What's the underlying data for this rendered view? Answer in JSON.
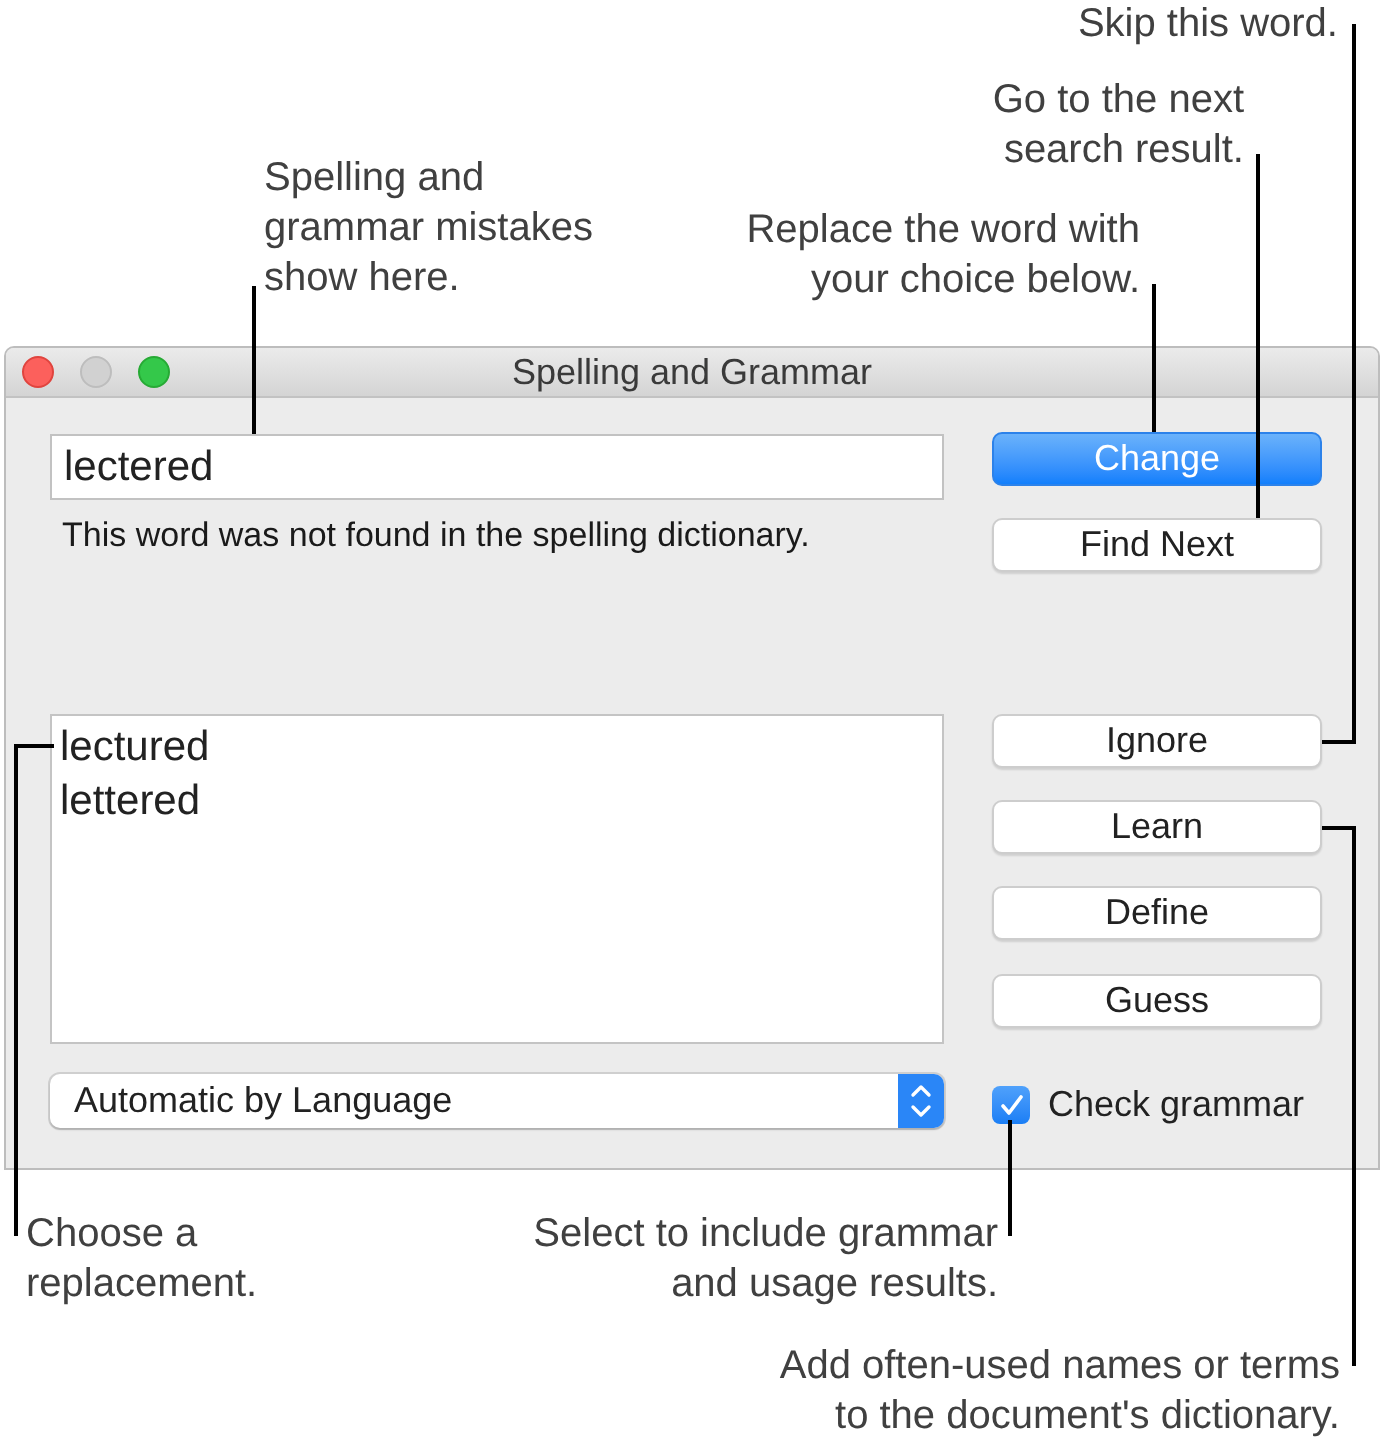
{
  "callouts_top": [
    {
      "lines": [
        "Skip this word."
      ]
    },
    {
      "lines": [
        "Go to the next",
        "search result."
      ]
    },
    {
      "lines": [
        "Spelling and",
        "grammar mistakes",
        "show here."
      ]
    },
    {
      "lines": [
        "Replace the word with",
        "your choice below."
      ]
    }
  ],
  "window": {
    "title": "Spelling and Grammar",
    "window_buttons": [
      {
        "kind": "close",
        "disabled": false
      },
      {
        "kind": "minimize",
        "disabled": true
      },
      {
        "kind": "zoom",
        "disabled": false
      }
    ],
    "misspelled_word": {
      "value": "lectered"
    },
    "message": "This word was not found in the spelling dictionary.",
    "guesses": [
      {
        "text": "lectured",
        "selected": false
      },
      {
        "text": "lettered",
        "selected": false
      }
    ],
    "language_popup": {
      "value": "Automatic by Language"
    },
    "buttons": [
      {
        "label": "Change",
        "default": true
      },
      {
        "label": "Find Next",
        "default": false
      },
      {
        "label": "Ignore",
        "default": false
      },
      {
        "label": "Learn",
        "default": false
      },
      {
        "label": "Define",
        "default": false
      },
      {
        "label": "Guess",
        "default": false
      }
    ],
    "check_grammar": {
      "label": "Check grammar",
      "checked": true
    }
  },
  "callouts_bottom": [
    {
      "lines": [
        "Choose a",
        "replacement."
      ]
    },
    {
      "lines": [
        "Select to include grammar",
        "and usage results."
      ]
    },
    {
      "lines": [
        "Add often-used names or terms",
        "to the document's dictionary."
      ]
    }
  ]
}
